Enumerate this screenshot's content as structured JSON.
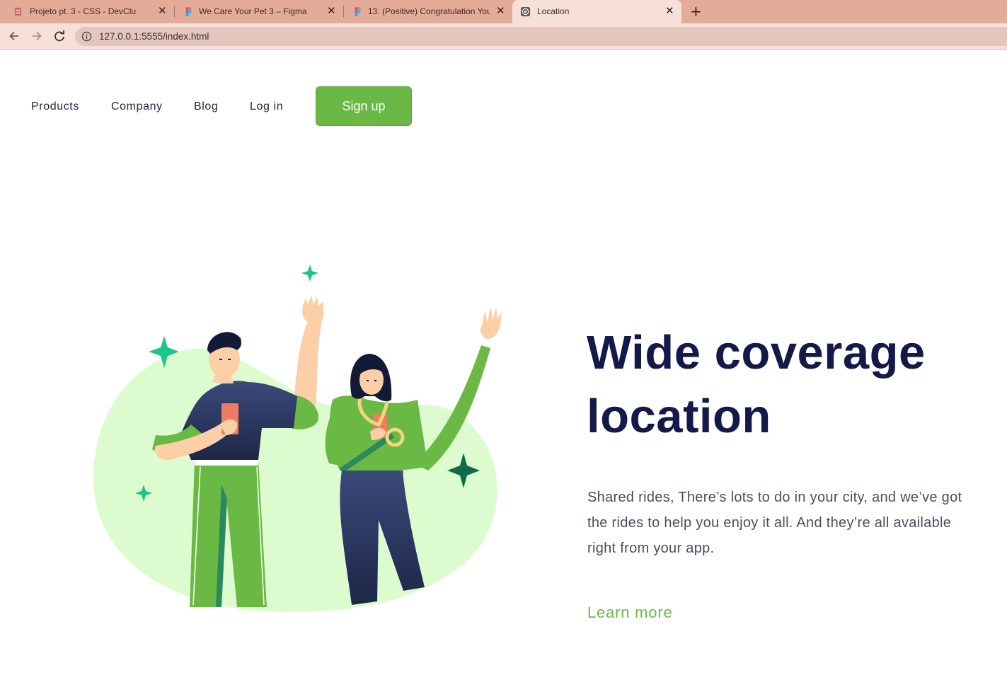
{
  "browser": {
    "tabs": [
      {
        "title": "Projeto pt. 3 - CSS - DevClub",
        "favicon": "devclub-icon"
      },
      {
        "title": "We Care Your Pet 3 – Figma",
        "favicon": "figma-icon"
      },
      {
        "title": "13. (Positive) Congratulation You",
        "favicon": "figma-icon"
      },
      {
        "title": "Location",
        "favicon": "globe-icon",
        "active": true
      }
    ],
    "close_glyph": "✕",
    "new_tab_glyph": "+",
    "url": "127.0.0.1:5555/index.html"
  },
  "nav": {
    "links": [
      "Products",
      "Company",
      "Blog",
      "Log in"
    ],
    "signup_label": "Sign up"
  },
  "hero": {
    "headline_line1": "Wide coverage",
    "headline_line2": "location",
    "description": "Shared rides, There’s lots to do in your city, and we’ve got the rides to help you enjoy it all. And they’re all available right from your app.",
    "cta": "Learn more",
    "illustration": "two-people-waving-illustration"
  },
  "colors": {
    "tabstrip": "#e5ab99",
    "toolbar": "#f7e0d9",
    "accent_green": "#6ab944",
    "headline_navy": "#131a4a",
    "blob": "#dcfccf"
  }
}
